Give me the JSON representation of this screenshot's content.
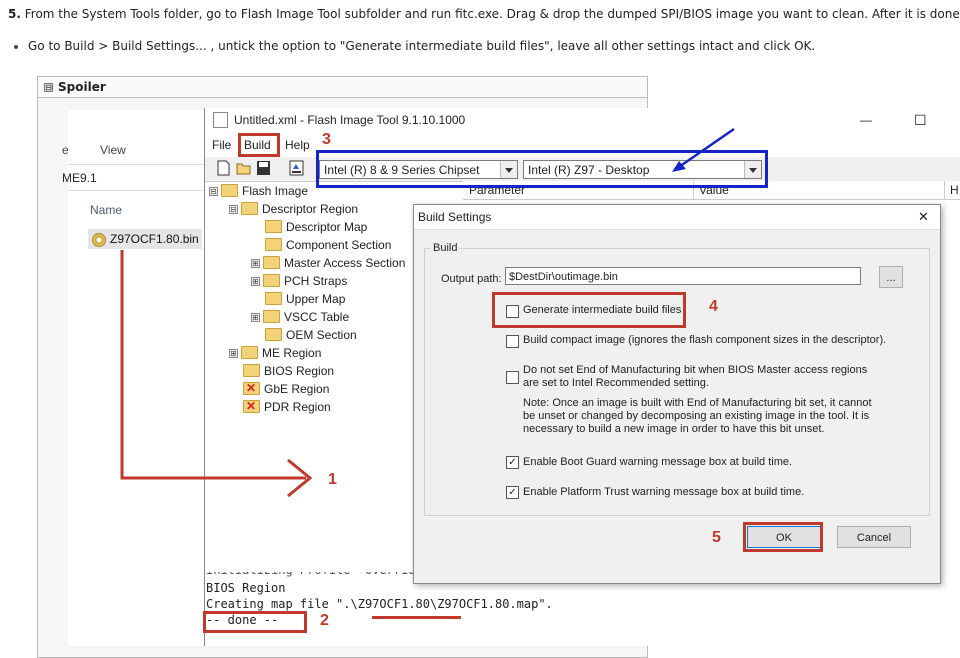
{
  "instructions": {
    "step_number": "5.",
    "step_text": "From the System Tools folder, go to Flash Image Tool subfolder and run fitc.exe. Drag & drop the dumped SPI/BIOS image you want to clean. After it is done load",
    "bullet": "Go to Build > Build Settings... , untick the option to \"Generate intermediate build files\", leave all other settings intact and click OK."
  },
  "spoiler": {
    "toggle": "⊟",
    "title": "Spoiler"
  },
  "explorer": {
    "col_view": "View",
    "col_e": "e",
    "path": "ME9.1",
    "col_name": "Name",
    "file": "Z97OCF1.80.bin"
  },
  "window": {
    "title": "Untitled.xml - Flash Image Tool 9.1.10.1000",
    "minimize": "—",
    "maximize": "☐",
    "menu": [
      "File",
      "Build",
      "Help"
    ],
    "chipset": "Intel (R) 8 & 9 Series Chipset",
    "platform": "Intel (R) Z97 - Desktop",
    "grid_headers": [
      "Parameter",
      "Value",
      "H"
    ]
  },
  "tree": [
    {
      "label": "Flash Image",
      "expander": "⊟"
    },
    {
      "label": "Descriptor Region",
      "expander": "⊟"
    },
    {
      "label": "Descriptor Map",
      "expander": ""
    },
    {
      "label": "Component Section",
      "expander": ""
    },
    {
      "label": "Master Access Section",
      "expander": "⊞"
    },
    {
      "label": "PCH Straps",
      "expander": "⊞"
    },
    {
      "label": "Upper Map",
      "expander": ""
    },
    {
      "label": "VSCC Table",
      "expander": "⊞"
    },
    {
      "label": "OEM Section",
      "expander": ""
    },
    {
      "label": "ME Region",
      "expander": "⊞"
    },
    {
      "label": "BIOS Region",
      "expander": ""
    },
    {
      "label": "GbE Region",
      "expander": ""
    },
    {
      "label": "PDR Region",
      "expander": ""
    }
  ],
  "log": [
    "BIOS Region",
    "Creating map file \".\\Z97OCF1.80\\Z97OCF1.80.map\".",
    "-- done --"
  ],
  "dialog": {
    "title": "Build Settings",
    "close": "✕",
    "group": "Build",
    "output_label": "Output path:",
    "output_value": "$DestDir\\outimage.bin",
    "browse": "...",
    "opt1": "Generate intermediate build files",
    "opt2": "Build compact image (ignores the flash component sizes in the descriptor).",
    "opt3_line1": "Do not set End of Manufacturing bit when BIOS Master access regions",
    "opt3_line2": "are set to Intel Recommended setting.",
    "note_line1": "Note: Once an image is built with End of Manufacturing bit set, it cannot",
    "note_line2": "be unset or changed by decomposing an existing image in the tool. It is",
    "note_line3": "necessary to build a new image in order to have this bit unset.",
    "opt4": "Enable Boot Guard warning message box at build time.",
    "opt5": "Enable Platform Trust warning message box at build time.",
    "checkmark": "✓",
    "ok": "OK",
    "cancel": "Cancel"
  },
  "annotations": {
    "n1": "1",
    "n2": "2",
    "n3": "3",
    "n4": "4",
    "n5": "5"
  },
  "colors": {
    "annotation_red": "#c0392b",
    "annotation_blue": "#1523c8"
  }
}
